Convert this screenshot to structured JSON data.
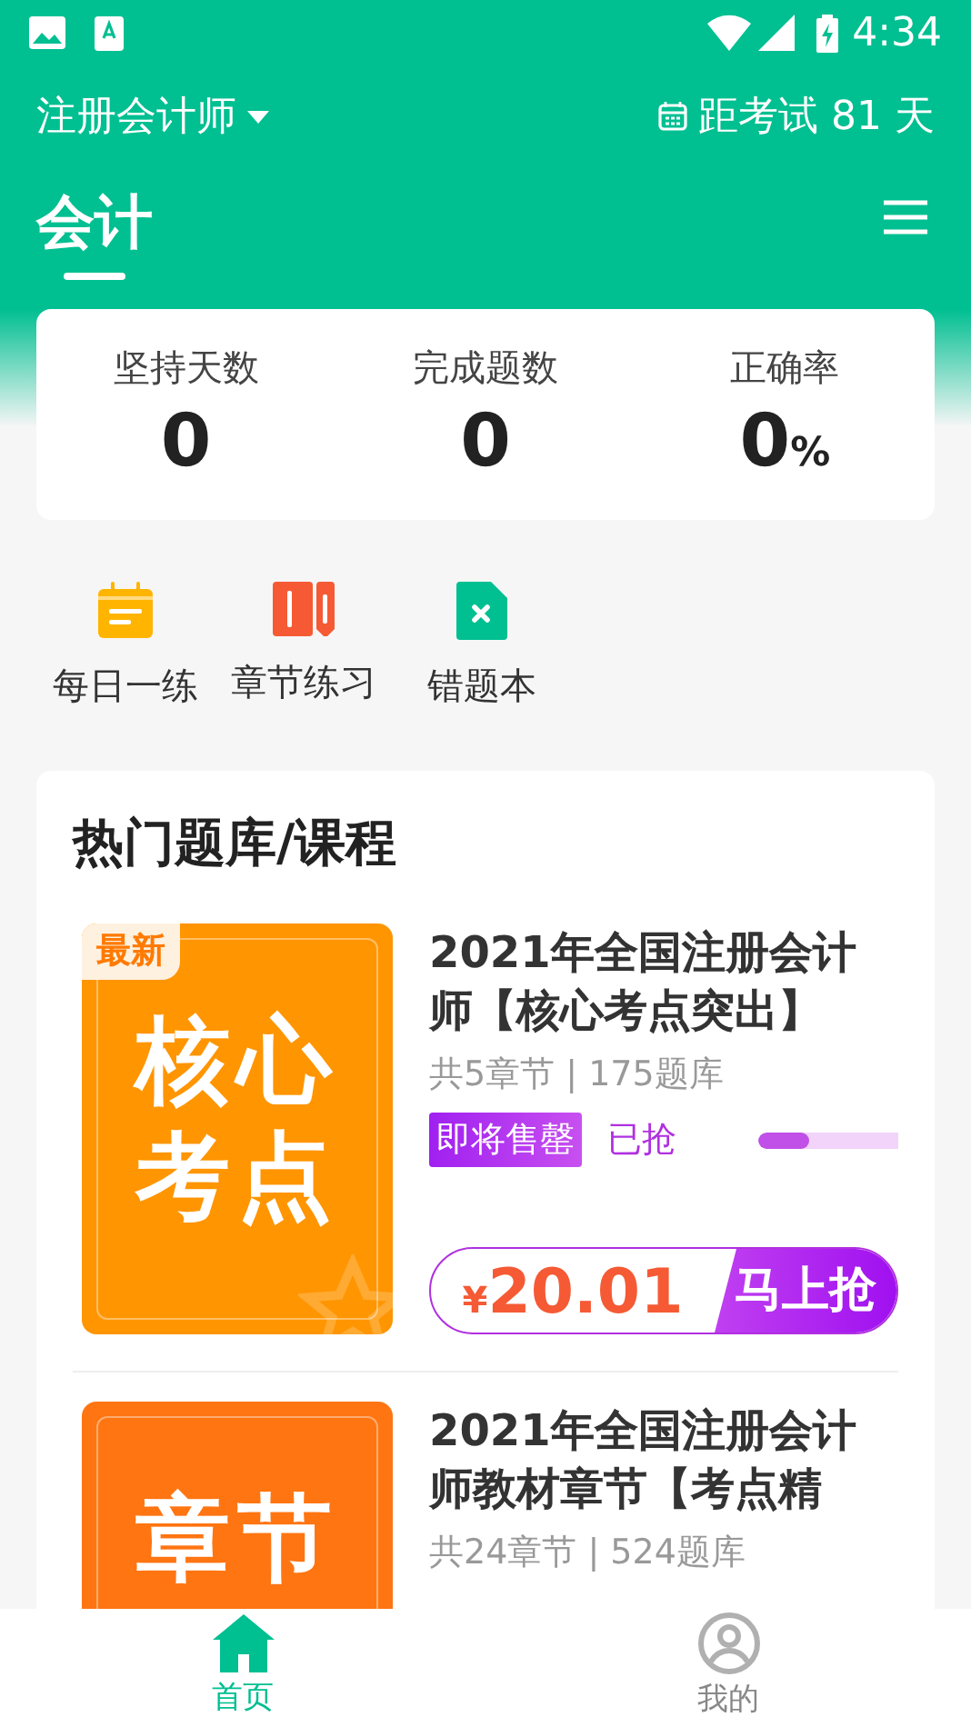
{
  "status_bar": {
    "time": "4:34"
  },
  "header": {
    "exam": "注册会计师",
    "countdown": "距考试 81 天"
  },
  "tabs": [
    {
      "label": "会计",
      "selected": true
    }
  ],
  "stats": [
    {
      "label": "坚持天数",
      "value": "0"
    },
    {
      "label": "完成题数",
      "value": "0"
    },
    {
      "label": "正确率",
      "value": "0",
      "unit": "%"
    }
  ],
  "shortcuts": [
    {
      "label": "每日一练",
      "kind": "calendar"
    },
    {
      "label": "章节练习",
      "kind": "book"
    },
    {
      "label": "错题本",
      "kind": "wrong"
    }
  ],
  "section": {
    "title": "热门题库/课程"
  },
  "courses": [
    {
      "cover_text": [
        "核心",
        "考点"
      ],
      "cover_badge": "最新",
      "color": "#ff9500",
      "title": "2021年全国注册会计师【核心考点突出】",
      "meta": "共5章节 | 175题库",
      "tag": "即将售罄",
      "sold_label": "已抢",
      "level": 0.37,
      "currency": "¥",
      "price": "20.01",
      "cta": "马上抢"
    },
    {
      "cover_text": [
        "章节"
      ],
      "color": "#ff7512",
      "title": "2021年全国注册会计师教材章节【考点精",
      "meta": "共24章节 | 524题库"
    }
  ],
  "bottom_nav": [
    {
      "label": "首页",
      "selected": true,
      "kind": "home"
    },
    {
      "label": "我的",
      "selected": false,
      "kind": "profile"
    }
  ]
}
